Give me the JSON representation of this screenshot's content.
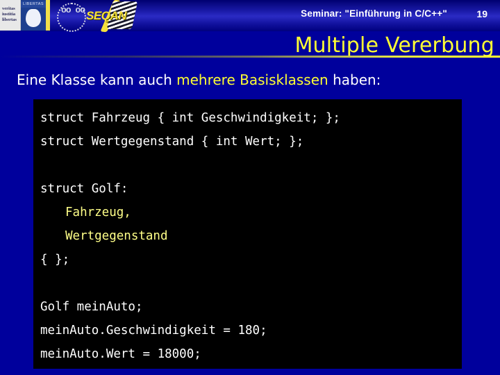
{
  "header": {
    "seminar_title": "Seminar: \"Einführung in C/C++\"",
    "page_number": "19",
    "logo_fu": {
      "motto_line1": "veritas",
      "motto_line2": "iustitia",
      "motto_line3": "libertas",
      "crest_band": "LIBERTAS"
    },
    "logo_seqan": {
      "wordmark": "SEQAN",
      "dots_mark": "oo\noo"
    }
  },
  "slide": {
    "title": "Multiple Vererbung",
    "subtitle": {
      "part1": "Eine Klasse kann auch ",
      "highlight": "mehrere Basisklassen",
      "part2": " haben:"
    }
  },
  "code": {
    "lines": [
      {
        "text": "struct Fahrzeug { int Geschwindigkeit; };",
        "style": "plain"
      },
      {
        "text": "struct Wertgegenstand { int Wert; };",
        "style": "plain"
      },
      {
        "text": " ",
        "style": "blank"
      },
      {
        "text": "struct Golf:",
        "style": "plain"
      },
      {
        "text": "Fahrzeug,",
        "style": "accent-indent"
      },
      {
        "text": "Wertgegenstand",
        "style": "accent-indent"
      },
      {
        "text": "{ };",
        "style": "plain"
      },
      {
        "text": " ",
        "style": "blank"
      },
      {
        "text": "Golf meinAuto;",
        "style": "plain"
      },
      {
        "text": "meinAuto.Geschwindigkeit = 180;",
        "style": "plain"
      },
      {
        "text": "meinAuto.Wert = 18000;",
        "style": "plain"
      }
    ]
  },
  "colors": {
    "background": "#00009c",
    "title_yellow": "#ffff33",
    "code_accent": "#ffff88",
    "code_background": "#000000",
    "text_white": "#ffffff"
  }
}
